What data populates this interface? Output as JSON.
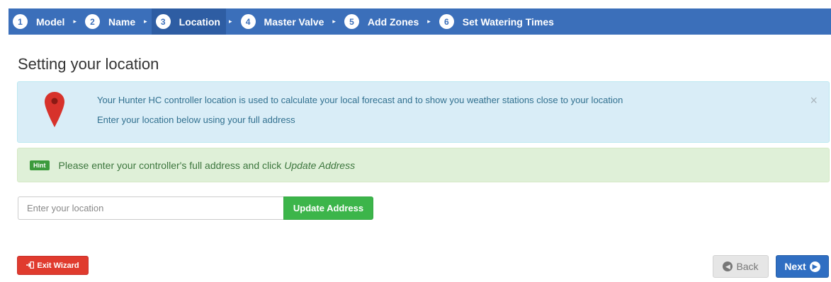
{
  "wizard": {
    "steps": [
      {
        "num": "1",
        "label": "Model"
      },
      {
        "num": "2",
        "label": "Name"
      },
      {
        "num": "3",
        "label": "Location"
      },
      {
        "num": "4",
        "label": "Master Valve"
      },
      {
        "num": "5",
        "label": "Add Zones"
      },
      {
        "num": "6",
        "label": "Set Watering Times"
      }
    ],
    "active_step": 3,
    "separator": "▸"
  },
  "page": {
    "title": "Setting your location"
  },
  "info_alert": {
    "line1": "Your Hunter HC controller location is used to calculate your local forecast and to show you weather stations close to your location",
    "line2": "Enter your location below using your full address",
    "close": "×",
    "icon": "map-pin-icon"
  },
  "hint_alert": {
    "badge": "Hint",
    "text": "Please enter your controller's full address and click",
    "emphasis": "Update Address"
  },
  "location": {
    "placeholder": "Enter your location",
    "value": "",
    "button_label": "Update Address"
  },
  "footer": {
    "exit_label": "Exit Wizard",
    "back_label": "Back",
    "next_label": "Next"
  },
  "colors": {
    "step_bar": "#3b6fba",
    "info_bg": "#d9edf7",
    "hint_bg": "#dff0d8",
    "update_button": "#3cb54a",
    "exit_button": "#e03b2e",
    "next_button": "#2f6ec2",
    "pin": "#d7322b"
  }
}
